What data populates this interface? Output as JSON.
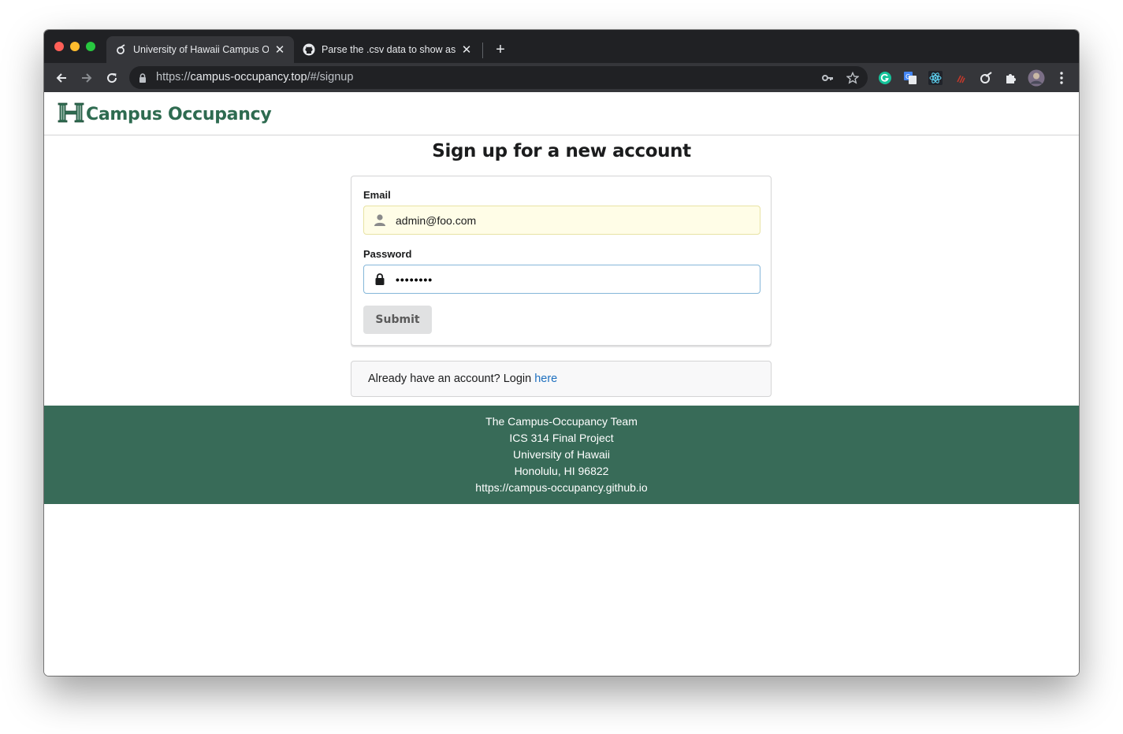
{
  "browser": {
    "tabs": [
      {
        "title": "University of Hawaii Campus Occupancy",
        "favicon": "campus-occupancy-favicon",
        "active": true
      },
      {
        "title": "Parse the .csv data to show as",
        "favicon": "github-icon",
        "active": false
      }
    ],
    "url": {
      "scheme": "https://",
      "host": "campus-occupancy.top",
      "path": "/#/signup"
    }
  },
  "app": {
    "brand": "Campus Occupancy",
    "logo": "uh-h-logo",
    "brand_color": "#2e6b50"
  },
  "signup": {
    "heading": "Sign up for a new account",
    "email_label": "Email",
    "email_value": "admin@foo.com",
    "email_icon": "user-icon",
    "password_label": "Password",
    "password_value": "••••••••",
    "password_icon": "lock-icon",
    "submit_label": "Submit",
    "login_prompt": "Already have an account? Login ",
    "login_link": "here",
    "link_color": "#1e70bf"
  },
  "footer": {
    "lines": [
      "The Campus-Occupancy Team",
      "ICS 314 Final Project",
      "University of Hawaii",
      "Honolulu, HI 96822",
      "https://campus-occupancy.github.io"
    ],
    "background": "#386b58"
  }
}
